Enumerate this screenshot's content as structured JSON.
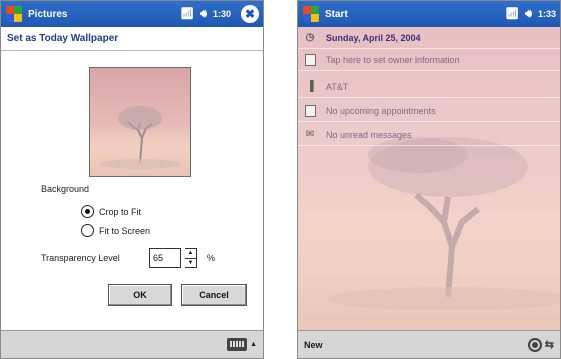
{
  "left_screen": {
    "titlebar": {
      "title": "Pictures",
      "connectivity_icon": "antenna-icon",
      "volume_icon": "speaker-icon",
      "time": "1:30",
      "close_icon": "close-icon"
    },
    "subheader": "Set as Today Wallpaper",
    "background_label": "Background",
    "radio_crop": "Crop to Fit",
    "radio_fit": "Fit to Screen",
    "selected_option": "Crop to Fit",
    "transparency_label": "Transparency Level",
    "transparency_value": "65",
    "percent_sign": "%",
    "ok_label": "OK",
    "cancel_label": "Cancel",
    "keyboard_icon": "keyboard-icon"
  },
  "right_screen": {
    "titlebar": {
      "title": "Start",
      "connectivity_icon": "antenna-icon",
      "volume_icon": "speaker-icon",
      "time": "1:33"
    },
    "rows": [
      {
        "icon": "calendar-date-icon",
        "text": "Sunday, April 25, 2004"
      },
      {
        "icon": "owner-info-icon",
        "text": "Tap here to set owner information"
      },
      {
        "icon": "signal-icon",
        "text": "AT&T"
      },
      {
        "icon": "appointments-icon",
        "text": "No upcoming appointments"
      },
      {
        "icon": "messages-icon",
        "text": "No unread messages"
      }
    ],
    "menubar_left": "New",
    "tray_icons": [
      "network-icon",
      "sync-icon"
    ]
  },
  "colors": {
    "titlebar": "#1f58b3",
    "wallpaper": "#eccaca",
    "date_text": "#3e2f7a"
  }
}
